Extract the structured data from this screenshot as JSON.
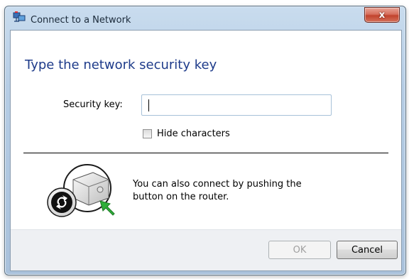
{
  "window": {
    "title": "Connect to a Network",
    "close_label": "x"
  },
  "main": {
    "instruction": "Type the network security key",
    "security_key": {
      "label": "Security key:",
      "value": ""
    },
    "hide_characters": {
      "label": "Hide characters",
      "checked": false
    },
    "wps": {
      "line1": "You can also connect by pushing the",
      "line2": "button on the router."
    }
  },
  "footer": {
    "ok_label": "OK",
    "ok_enabled": false,
    "cancel_label": "Cancel"
  },
  "colors": {
    "instruction_text": "#1e3b8a",
    "close_button": "#c1432d",
    "arrow_green": "#2fae3a"
  },
  "icons": {
    "title": "network-icon",
    "wps": "router-wps-icon",
    "arrow": "green-arrow-icon"
  }
}
